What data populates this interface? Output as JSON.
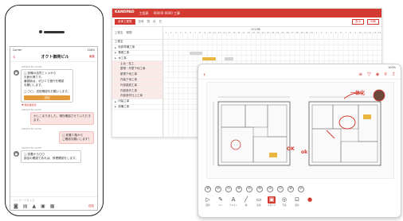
{
  "gantt": {
    "brand": "KANDPAD",
    "project": "工程表",
    "title_info": "00000 0000 工事",
    "toolbar_left": "全体工程表",
    "toolbar_right_1": "表示",
    "toolbar_right_2": "印刷",
    "tools": [
      "全体",
      "週",
      "月",
      "日"
    ],
    "side_head_1": "工程名",
    "side_head_2": "期間",
    "month_label": "2019年",
    "rows": [
      {
        "label": "工程名",
        "level": 0
      },
      {
        "label": "仮設準備工事",
        "level": 0,
        "expand": true
      },
      {
        "label": "基礎工事",
        "level": 0,
        "expand": true
      },
      {
        "label": "木工事",
        "level": 0,
        "expand": true
      },
      {
        "label": "土台・柱工",
        "level": 2
      },
      {
        "label": "屋根・外壁下地工事",
        "level": 2
      },
      {
        "label": "屋根下地工事",
        "level": 2
      },
      {
        "label": "内装下地工事",
        "level": 2
      },
      {
        "label": "外部建具工事",
        "level": 2
      },
      {
        "label": "内部造作工事",
        "level": 2
      },
      {
        "label": "内部造作仕上工事",
        "level": 2
      },
      {
        "label": "内装工事",
        "level": 0,
        "expand": true
      },
      {
        "label": "設備工事",
        "level": 0,
        "expand": true
      }
    ],
    "bars": [
      {
        "row": 2,
        "start": 0.12,
        "width": 0.06,
        "color": "gray"
      },
      {
        "row": 3,
        "start": 0.18,
        "width": 0.06,
        "color": "yellow"
      },
      {
        "row": 3,
        "start": 0.28,
        "width": 0.04,
        "color": "gray"
      }
    ]
  },
  "tablet": {
    "status": "100%",
    "header_icons": [
      "list-icon",
      "filter-icon",
      "layers-icon",
      "pin-icon",
      "share-icon"
    ],
    "tools_row1": [
      "⊕",
      "⊖",
      "⊙",
      "⊗",
      "⊘",
      "⊕",
      "⊖",
      "⊙",
      "⊗",
      "⊘"
    ],
    "tools_row2": [
      {
        "icon": "▷",
        "label": "選択"
      },
      {
        "icon": "✎",
        "label": "ペン"
      },
      {
        "icon": "A",
        "label": "テキスト"
      },
      {
        "icon": "╱",
        "label": "線"
      },
      {
        "icon": "▭",
        "label": "四角"
      },
      {
        "icon": "▣",
        "label": "スタンプ",
        "active": true
      },
      {
        "icon": "◎",
        "label": "写真"
      },
      {
        "icon": "⊡",
        "label": "保存"
      },
      {
        "icon": "●",
        "label": "",
        "red": true
      }
    ],
    "drawing_annotations": {
      "label1": "一体化",
      "label2": "OK",
      "label3": "ok"
    }
  },
  "phone": {
    "status_left": "Carrier",
    "status_right": "100%",
    "title": "オクト御苑ビル",
    "menu": "編集",
    "messages": [
      {
        "meta": "2019/7/30 14:28",
        "lines": [
          "□ 設備の品質とトメから",
          "お疲れ様です。",
          "廉価版は、ぜひ１で進行を確認",
          "お願いします。",
          "",
          "□ 〇〇、送信確認をお願いします。"
        ],
        "button": "送信",
        "pink": false
      },
      {
        "reaction": "♥ 既読確認済"
      },
      {
        "meta": "2019/7/30 14:31",
        "lines": [
          "かしこまりました。現在確認させていただきます。"
        ],
        "pink": true,
        "right": true
      },
      {
        "meta": "2019/7/30 14:39",
        "lines": [
          "□ 設置１階から",
          "ご確認お願いします？"
        ],
        "pink": true,
        "right": true
      },
      {
        "meta": "2019/7/30 14:55",
        "lines": [
          "□ 設置から〇〇",
          "部品の確認であれば、修理確認をします。"
        ],
        "pink": false
      }
    ],
    "input_placeholder": "メッセージを入力",
    "bar_icons": [
      "camera-icon",
      "file-icon",
      "text-icon",
      "image-icon",
      "grid-icon"
    ],
    "send": "送信"
  }
}
